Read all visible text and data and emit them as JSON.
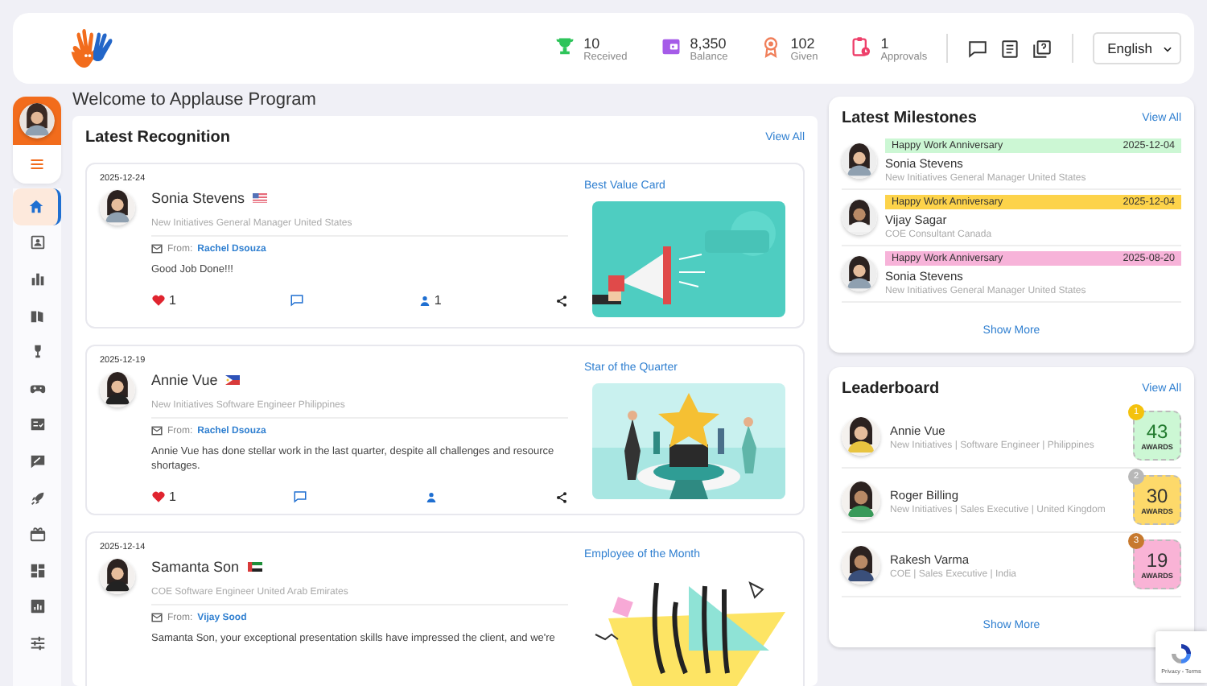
{
  "header": {
    "stats": [
      {
        "value": "10",
        "label": "Received"
      },
      {
        "value": "8,350",
        "label": "Balance"
      },
      {
        "value": "102",
        "label": "Given"
      },
      {
        "value": "1",
        "label": "Approvals"
      }
    ],
    "language": "English"
  },
  "sidebar": {
    "items": [
      {
        "selected": true
      },
      {
        "selected": false
      },
      {
        "selected": false
      },
      {
        "selected": false
      },
      {
        "selected": false
      },
      {
        "selected": false
      },
      {
        "selected": false
      },
      {
        "selected": false
      },
      {
        "selected": false
      },
      {
        "selected": false
      },
      {
        "selected": false
      },
      {
        "selected": false
      },
      {
        "selected": false
      }
    ]
  },
  "page_title": "Welcome to Applause Program",
  "recognition": {
    "title": "Latest Recognition",
    "view_all": "View All",
    "posts": [
      {
        "date": "2025-12-24",
        "name": "Sonia Stevens",
        "kind": "us",
        "subtitle": "New Initiatives General Manager United States",
        "from_label": "From:",
        "from": "Rachel Dsouza",
        "message": "Good Job Done!!!",
        "likes": "1",
        "recipients": "1",
        "award": "Best Value Card"
      },
      {
        "date": "2025-12-19",
        "name": "Annie Vue",
        "kind": "ph",
        "subtitle": "New Initiatives Software Engineer Philippines",
        "from_label": "From:",
        "from": "Rachel Dsouza",
        "message": "Annie Vue has done stellar work in the last quarter, despite all challenges and resource shortages.",
        "likes": "1",
        "award": "Star of the Quarter"
      },
      {
        "date": "2025-12-14",
        "name": "Samanta Son",
        "kind": "ae",
        "subtitle": "COE Software Engineer United Arab Emirates",
        "from_label": "From:",
        "from": "Vijay Sood",
        "message": "Samanta Son, your exceptional presentation skills have impressed the client, and we're",
        "award": "Employee of the Month"
      }
    ]
  },
  "milestones": {
    "title": "Latest Milestones",
    "view_all": "View All",
    "items": [
      {
        "label": "Happy Work Anniversary",
        "date": "2025-12-04",
        "color": "#ccf7d4",
        "name": "Sonia Stevens",
        "subtitle": "New Initiatives General Manager United States"
      },
      {
        "label": "Happy Work Anniversary",
        "date": "2025-12-04",
        "color": "#fdd34a",
        "name": "Vijay Sagar",
        "subtitle": "COE Consultant Canada"
      },
      {
        "label": "Happy Work Anniversary",
        "date": "2025-08-20",
        "color": "#f7b3d9",
        "name": "Sonia Stevens",
        "subtitle": "New Initiatives General Manager United States"
      }
    ],
    "show_more": "Show More"
  },
  "leaderboard": {
    "title": "Leaderboard",
    "view_all": "View All",
    "items": [
      {
        "name": "Annie Vue",
        "subtitle": "New Initiatives | Software Engineer | Philippines",
        "rank": "1",
        "count": "43",
        "unit": "AWARDS",
        "color": "#ccf7d4"
      },
      {
        "name": "Roger Billing",
        "subtitle": "New Initiatives | Sales Executive | United Kingdom",
        "rank": "2",
        "count": "30",
        "unit": "AWARDS",
        "color": "#fdd96a"
      },
      {
        "name": "Rakesh Varma",
        "subtitle": "COE | Sales Executive | India",
        "rank": "3",
        "count": "19",
        "unit": "AWARDS",
        "color": "#f9b3d6"
      }
    ],
    "show_more": "Show More"
  },
  "recaptcha": "Privacy - Terms"
}
